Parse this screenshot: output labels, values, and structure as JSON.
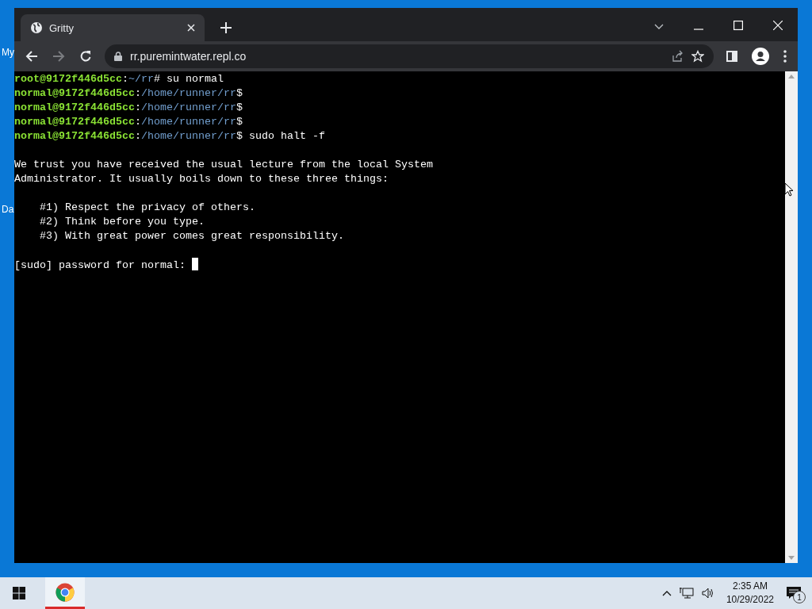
{
  "desktop_icons": [
    {
      "label": "My"
    },
    {
      "label": "Da"
    }
  ],
  "browser": {
    "tab": {
      "title": "Gritty"
    },
    "address": "rr.puremintwater.repl.co"
  },
  "terminal": {
    "blocks": [
      {
        "lines": [
          [
            {
              "kind": "user",
              "text": "root@9172f446d5cc"
            },
            {
              "kind": "text",
              "text": ":"
            },
            {
              "kind": "path",
              "text": "~/rr"
            },
            {
              "kind": "text",
              "text": "# su normal"
            }
          ],
          [
            {
              "kind": "user",
              "text": "normal@9172f446d5cc"
            },
            {
              "kind": "text",
              "text": ":"
            },
            {
              "kind": "path",
              "text": "/home/runner/rr"
            },
            {
              "kind": "text",
              "text": "$"
            }
          ],
          [
            {
              "kind": "user",
              "text": "normal@9172f446d5cc"
            },
            {
              "kind": "text",
              "text": ":"
            },
            {
              "kind": "path",
              "text": "/home/runner/rr"
            },
            {
              "kind": "text",
              "text": "$"
            }
          ],
          [
            {
              "kind": "user",
              "text": "normal@9172f446d5cc"
            },
            {
              "kind": "text",
              "text": ":"
            },
            {
              "kind": "path",
              "text": "/home/runner/rr"
            },
            {
              "kind": "text",
              "text": "$"
            }
          ],
          [
            {
              "kind": "user",
              "text": "normal@9172f446d5cc"
            },
            {
              "kind": "text",
              "text": ":"
            },
            {
              "kind": "path",
              "text": "/home/runner/rr"
            },
            {
              "kind": "text",
              "text": "$ sudo halt -f"
            }
          ]
        ]
      },
      {
        "lines": [
          [
            {
              "kind": "text",
              "text": "We trust you have received the usual lecture from the local System"
            }
          ],
          [
            {
              "kind": "text",
              "text": "Administrator. It usually boils down to these three things:"
            }
          ]
        ]
      },
      {
        "lines": [
          [
            {
              "kind": "text",
              "text": "    #1) Respect the privacy of others."
            }
          ],
          [
            {
              "kind": "text",
              "text": "    #2) Think before you type."
            }
          ],
          [
            {
              "kind": "text",
              "text": "    #3) With great power comes great responsibility."
            }
          ]
        ]
      },
      {
        "lines": [
          [
            {
              "kind": "text",
              "text": "[sudo] password for normal: "
            },
            {
              "kind": "cursor"
            }
          ]
        ]
      }
    ]
  },
  "taskbar": {
    "time": "2:35 AM",
    "date": "10/29/2022",
    "notification_count": "1"
  }
}
